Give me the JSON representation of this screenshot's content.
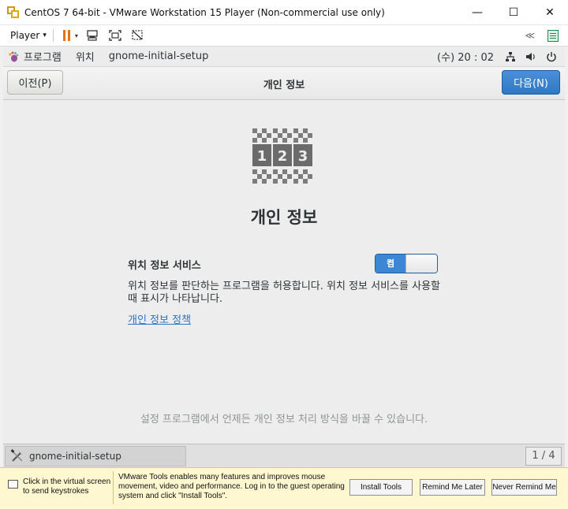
{
  "window": {
    "title": "CentOS 7 64-bit - VMware Workstation 15 Player (Non-commercial use only)",
    "minimize": "—",
    "maximize": "☐",
    "close": "✕"
  },
  "vm_toolbar": {
    "player_menu": "Player",
    "player_caret": "▾",
    "pause_caret": "▾",
    "collapse_glyph": "≪"
  },
  "gnome_bar": {
    "applications": "프로그램",
    "places": "위치",
    "app_name": "gnome-initial-setup",
    "clock": "(수) 20 : 02"
  },
  "header": {
    "prev_button": "이전(P)",
    "title": "개인 정보",
    "next_button": "다음(N)"
  },
  "content": {
    "icon_digits": [
      "1",
      "2",
      "3"
    ],
    "heading": "개인 정보",
    "location_label": "위치 정보 서비스",
    "switch_on_label": "켬",
    "location_desc": "위치 정보를 판단하는 프로그램을 허용합니다. 위치 정보 서비스를 사용할 때 표시가 나타납니다.",
    "policy_link": "개인 정보 정책",
    "footer_note": "설정 프로그램에서 언제든 개인 정보 처리 방식을 바꿀 수 있습니다."
  },
  "taskbar": {
    "task_label": "gnome-initial-setup",
    "workspace": "1 / 4"
  },
  "tools_bar": {
    "click_info": "Click in the virtual screen to send keystrokes",
    "message": "VMware Tools enables many features and improves mouse movement, video and performance. Log in to the guest operating system and click \"Install Tools\".",
    "install_button": "Install Tools",
    "remind_later_button": "Remind Me Later",
    "never_remind_button": "Never Remind Me"
  },
  "colors": {
    "accent_blue": "#3d86d4",
    "pause_orange": "#e8720c",
    "link_blue": "#2a76c6",
    "tools_bar_bg": "#fff7cf"
  }
}
